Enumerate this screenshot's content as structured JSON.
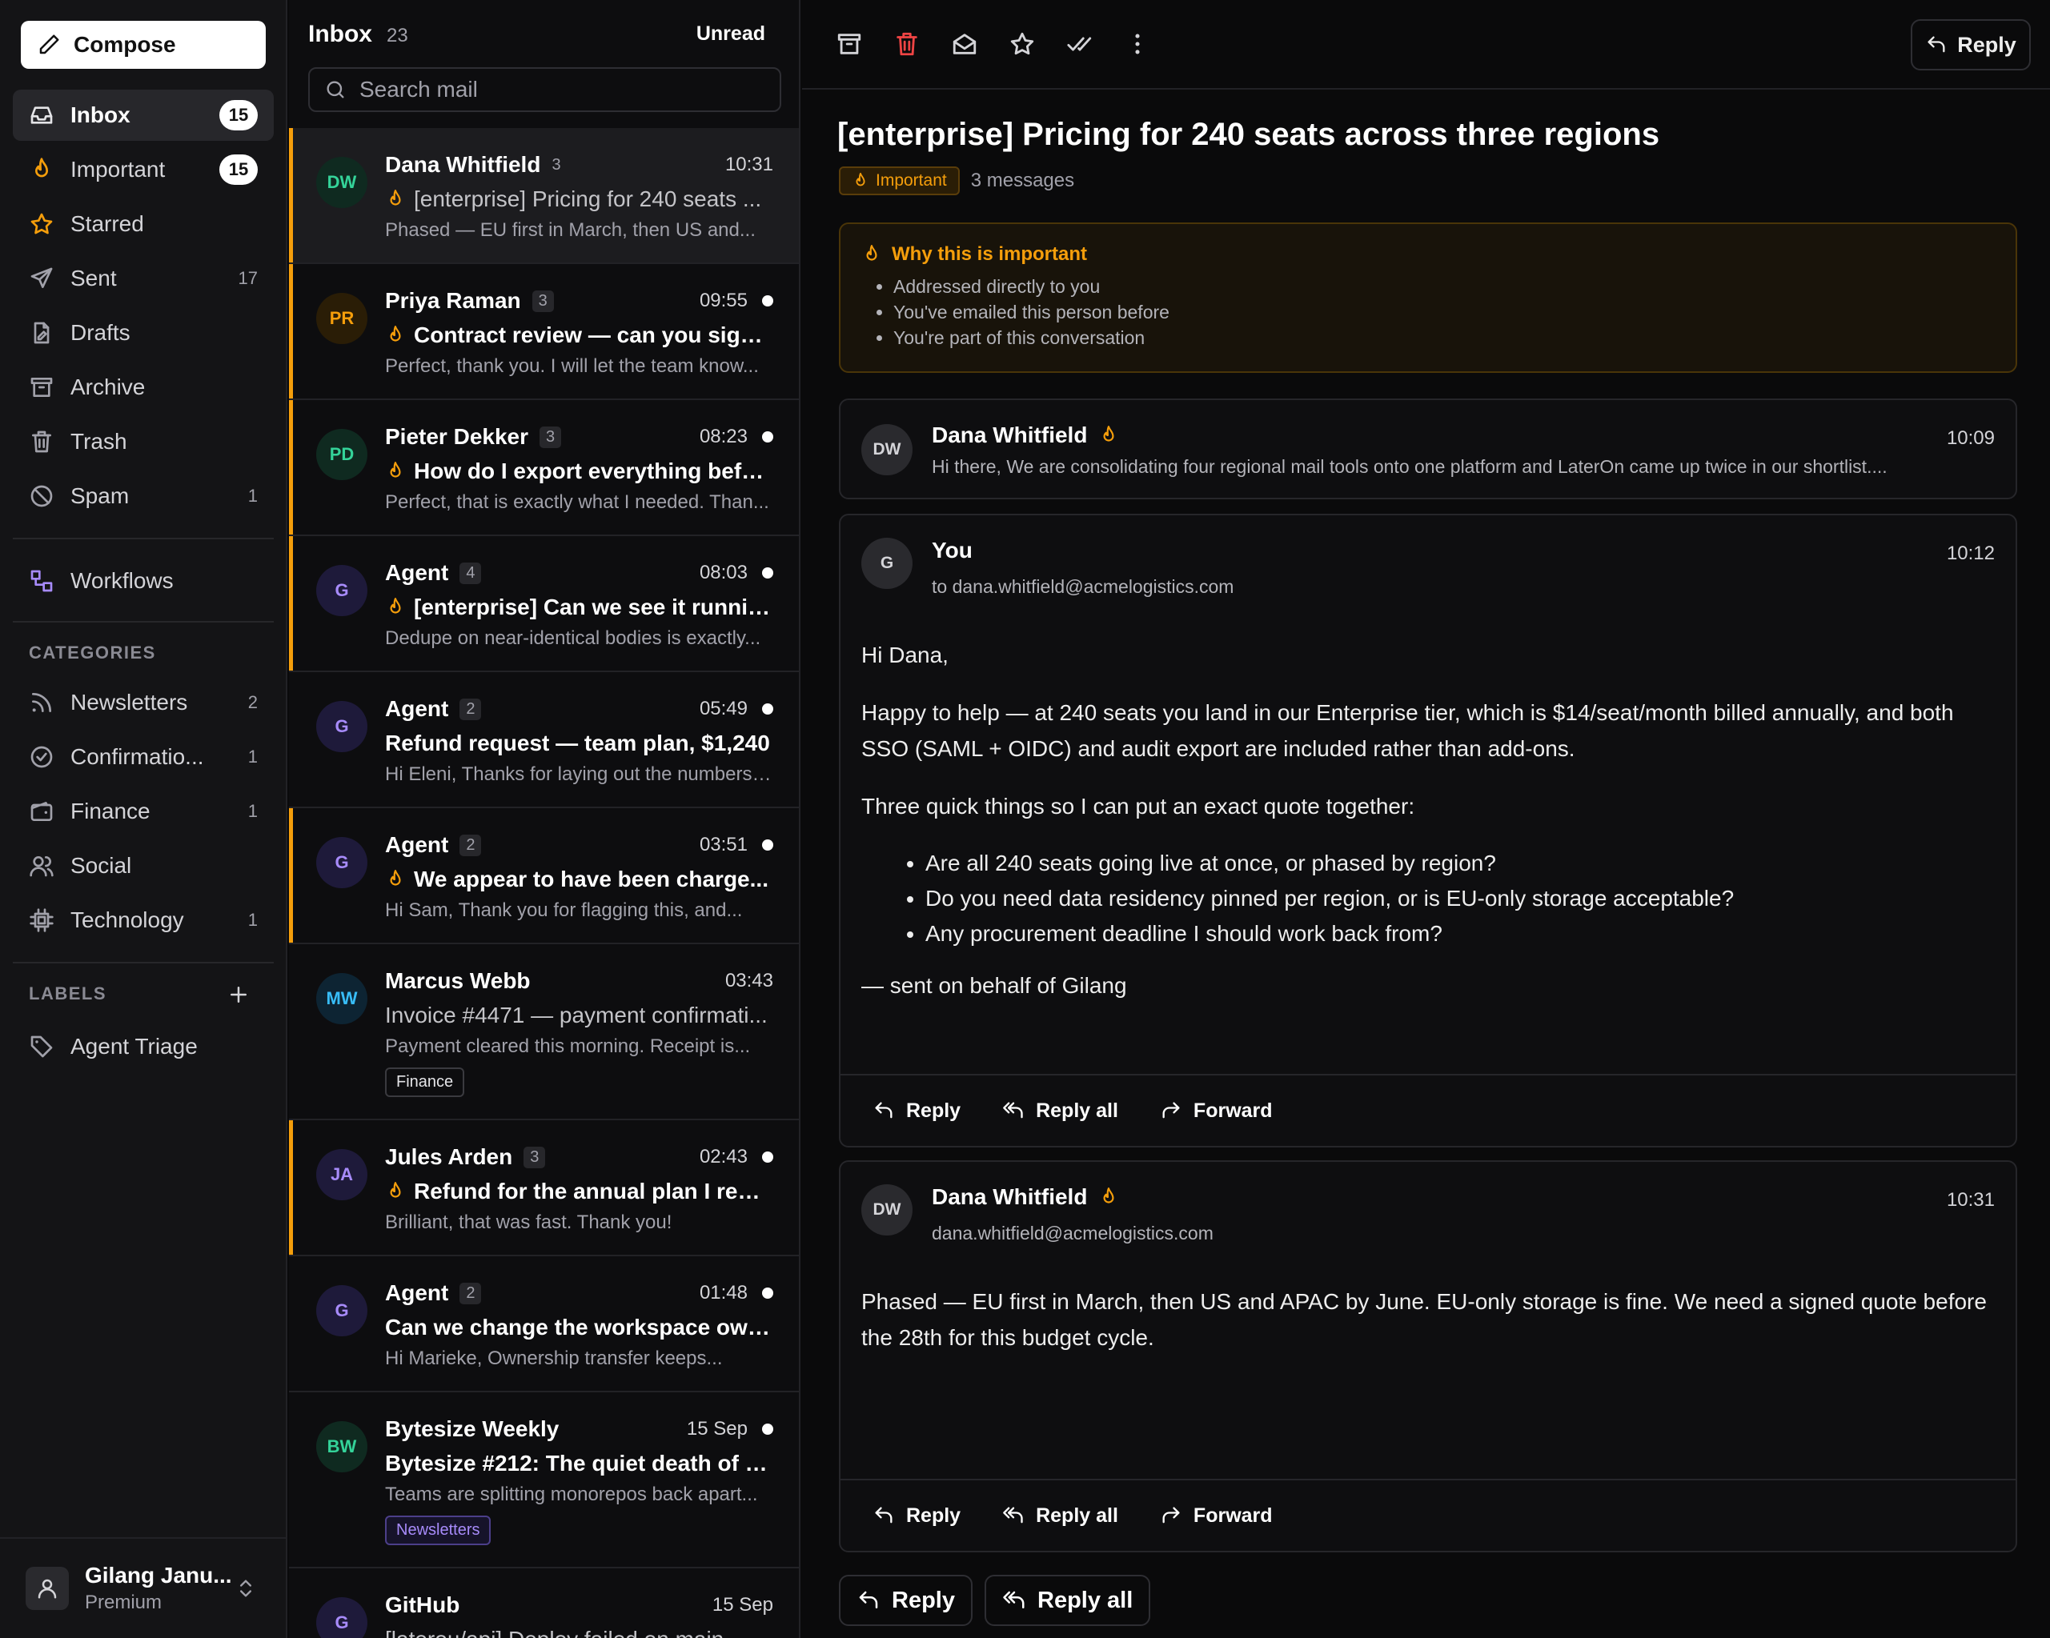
{
  "sidebar": {
    "compose_label": "Compose",
    "nav": [
      {
        "label": "Inbox",
        "count": "15",
        "icon": "inbox-icon"
      },
      {
        "label": "Important",
        "count": "15",
        "icon": "flame-icon"
      },
      {
        "label": "Starred",
        "count": "",
        "icon": "star-icon"
      },
      {
        "label": "Sent",
        "count": "17",
        "icon": "send-icon"
      },
      {
        "label": "Drafts",
        "count": "",
        "icon": "draft-icon"
      },
      {
        "label": "Archive",
        "count": "",
        "icon": "archive-icon"
      },
      {
        "label": "Trash",
        "count": "",
        "icon": "trash-icon"
      },
      {
        "label": "Spam",
        "count": "1",
        "icon": "ban-icon"
      }
    ],
    "workflows_label": "Workflows",
    "categories_heading": "CATEGORIES",
    "categories": [
      {
        "label": "Newsletters",
        "count": "2"
      },
      {
        "label": "Confirmatio...",
        "count": "1"
      },
      {
        "label": "Finance",
        "count": "1"
      },
      {
        "label": "Social",
        "count": ""
      },
      {
        "label": "Technology",
        "count": "1"
      }
    ],
    "labels_heading": "LABELS",
    "labels": [
      {
        "label": "Agent Triage"
      }
    ],
    "user": {
      "name": "Gilang Janu...",
      "plan": "Premium"
    }
  },
  "list": {
    "title": "Inbox",
    "count": "23",
    "unread_label": "Unread",
    "search_placeholder": "Search mail",
    "rows": [
      {
        "initials": "DW",
        "sender": "Dana Whitfield",
        "count": "3",
        "time": "10:31",
        "unread": false,
        "important": true,
        "subject": "[enterprise] Pricing for 240 seats ...",
        "preview": "Phased — EU first in March, then US and...",
        "tag": ""
      },
      {
        "initials": "PR",
        "sender": "Priya Raman",
        "count": "3",
        "time": "09:55",
        "unread": true,
        "important": true,
        "subject": "Contract review — can you sign ...",
        "preview": "Perfect, thank you. I will let the team know...",
        "tag": ""
      },
      {
        "initials": "PD",
        "sender": "Pieter Dekker",
        "count": "3",
        "time": "08:23",
        "unread": true,
        "important": true,
        "subject": "How do I export everything befor...",
        "preview": "Perfect, that is exactly what I needed. Than...",
        "tag": ""
      },
      {
        "initials": "G",
        "sender": "Agent",
        "count": "4",
        "time": "08:03",
        "unread": true,
        "important": true,
        "subject": "[enterprise] Can we see it runnin...",
        "preview": "Dedupe on near-identical bodies is exactly...",
        "tag": ""
      },
      {
        "initials": "G",
        "sender": "Agent",
        "count": "2",
        "time": "05:49",
        "unread": true,
        "important": false,
        "subject": "Refund request — team plan, $1,240",
        "preview": "Hi Eleni, Thanks for laying out the numbers....",
        "tag": ""
      },
      {
        "initials": "G",
        "sender": "Agent",
        "count": "2",
        "time": "03:51",
        "unread": true,
        "important": true,
        "subject": "We appear to have been charge...",
        "preview": "Hi Sam, Thank you for flagging this, and...",
        "tag": ""
      },
      {
        "initials": "MW",
        "sender": "Marcus Webb",
        "count": "",
        "time": "03:43",
        "unread": false,
        "important": false,
        "subject": "Invoice #4471 — payment confirmati...",
        "preview": "Payment cleared this morning. Receipt is...",
        "tag": "Finance"
      },
      {
        "initials": "JA",
        "sender": "Jules Arden",
        "count": "3",
        "time": "02:43",
        "unread": true,
        "important": true,
        "subject": "Refund for the annual plan I rene...",
        "preview": "Brilliant, that was fast. Thank you!",
        "tag": ""
      },
      {
        "initials": "G",
        "sender": "Agent",
        "count": "2",
        "time": "01:48",
        "unread": true,
        "important": false,
        "subject": "Can we change the workspace own...",
        "preview": "Hi Marieke, Ownership transfer keeps...",
        "tag": ""
      },
      {
        "initials": "BW",
        "sender": "Bytesize Weekly",
        "count": "",
        "time": "15 Sep",
        "unread": true,
        "important": false,
        "subject": "Bytesize #212: The quiet death of th...",
        "preview": "Teams are splitting monorepos back apart...",
        "tag": "Newsletters"
      },
      {
        "initials": "G",
        "sender": "GitHub",
        "count": "",
        "time": "15 Sep",
        "unread": false,
        "important": false,
        "subject": "[laterон/api] Deploy failed on main",
        "preview": "",
        "tag": ""
      }
    ]
  },
  "reader": {
    "reply_label": "Reply",
    "title": "[enterprise] Pricing for 240 seats across three regions",
    "badge": "Important",
    "message_count": "3 messages",
    "why": {
      "title": "Why this is important",
      "reasons": [
        "Addressed directly to you",
        "You've emailed this person before",
        "You're part of this conversation"
      ]
    },
    "m1": {
      "initials": "DW",
      "name": "Dana Whitfield",
      "time": "10:09",
      "snippet": "Hi there, We are consolidating four regional mail tools onto one platform and LaterOn came up twice in our shortlist...."
    },
    "m2": {
      "initials": "G",
      "name": "You",
      "time": "10:12",
      "to": "to dana.whitfield@acmelogistics.com",
      "greeting": "Hi Dana,",
      "p1": "Happy to help — at 240 seats you land in our Enterprise tier, which is $14/seat/month billed annually, and both SSO (SAML + OIDC) and audit export are included rather than add-ons.",
      "p2": "Three quick things so I can put an exact quote together:",
      "bullets": [
        "Are all 240 seats going live at once, or phased by region?",
        "Do you need data residency pinned per region, or is EU-only storage acceptable?",
        "Any procurement deadline I should work back from?"
      ],
      "signoff": "— sent on behalf of Gilang"
    },
    "m3": {
      "initials": "DW",
      "name": "Dana Whitfield",
      "time": "10:31",
      "email": "dana.whitfield@acmelogistics.com",
      "body": "Phased — EU first in March, then US and APAC by June. EU-only storage is fine. We need a signed quote before the 28th for this budget cycle."
    },
    "actions": {
      "reply": "Reply",
      "reply_all": "Reply all",
      "forward": "Forward"
    },
    "bottom": {
      "reply": "Reply",
      "reply_all": "Reply all"
    }
  },
  "colors": {
    "accent": "#f59e0b",
    "background": "#0a0a0b",
    "sidebar": "#141416"
  }
}
